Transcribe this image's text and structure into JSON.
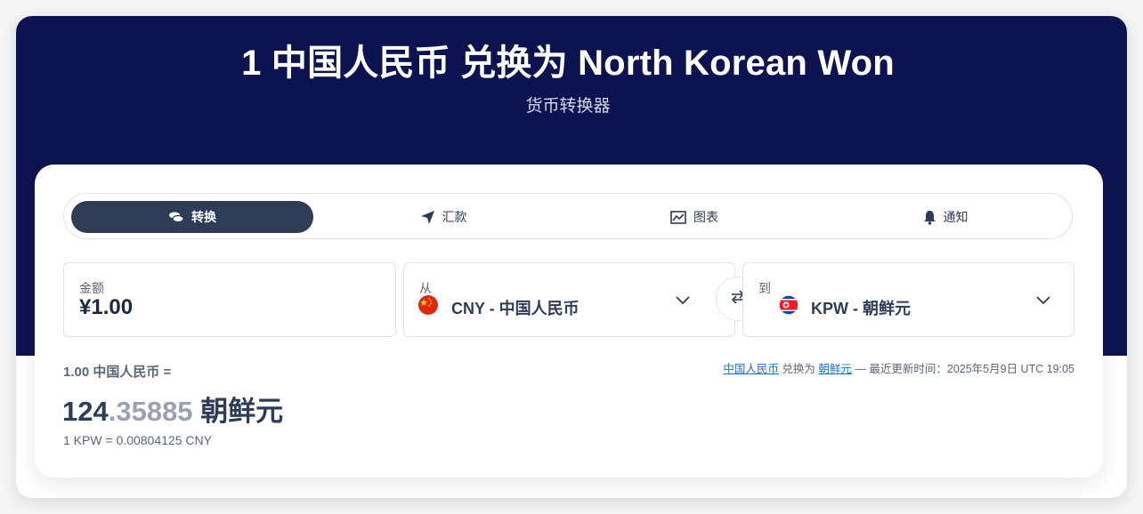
{
  "hero": {
    "title": "1 中国人民币 兑换为 North Korean Won",
    "subtitle": "货币转换器"
  },
  "tabs": [
    {
      "label": "转换",
      "icon": "coins-icon",
      "active": true
    },
    {
      "label": "汇款",
      "icon": "send-icon",
      "active": false
    },
    {
      "label": "图表",
      "icon": "chart-icon",
      "active": false
    },
    {
      "label": "通知",
      "icon": "bell-icon",
      "active": false
    }
  ],
  "amount": {
    "label": "金额",
    "value": "¥1.00"
  },
  "from": {
    "label": "从",
    "value": "CNY - 中国人民币",
    "flag": "china-flag-icon"
  },
  "to": {
    "label": "到",
    "value": "KPW - 朝鲜元",
    "flag": "north-korea-flag-icon"
  },
  "result": {
    "label": "1.00 中国人民币 =",
    "integer": "124",
    "decimals": ".35885",
    "currency": "朝鲜元",
    "inverse": "1 KPW = 0.00804125 CNY"
  },
  "update": {
    "from_link": "中国人民币",
    "connector": "兑换为",
    "to_link": "朝鲜元",
    "text": "— 最近更新时间：2025年5月9日 UTC 19:05"
  },
  "colors": {
    "hero_bg": "#0d1350",
    "active_tab": "#2e3c57",
    "link": "#1f6fc5"
  }
}
